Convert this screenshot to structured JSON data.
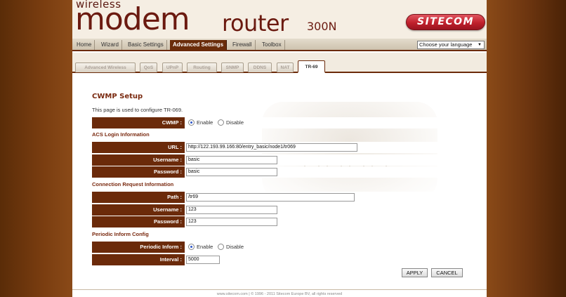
{
  "header": {
    "logo_top": "wireless",
    "logo_main": "modem",
    "logo_router": "router",
    "logo_model": "300N",
    "brand": "SITECOM"
  },
  "nav": {
    "items": [
      "Home",
      "Wizard",
      "Basic Settings",
      "Advanced Settings",
      "Firewall",
      "Toolbox"
    ],
    "active": "Advanced Settings",
    "language_select": "Choose your language"
  },
  "subtabs": {
    "items": [
      "Advanced Wireless",
      "QoS",
      "UPnP",
      "Routing",
      "SNMP",
      "DDNS",
      "NAT",
      "TR-69"
    ],
    "active": "TR-69"
  },
  "page": {
    "title": "CWMP Setup",
    "description": "This page is used to configure TR-069."
  },
  "cwmp": {
    "label": "CWMP :",
    "enable": "Enable",
    "disable": "Disable",
    "selected": "Enable"
  },
  "acs": {
    "section": "ACS Login Information",
    "url_label": "URL :",
    "url_value": "http://122.193.99.166:80/entry_basic/node1/tr069",
    "username_label": "Username :",
    "username_value": "basic",
    "password_label": "Password :",
    "password_value": "basic"
  },
  "conn_req": {
    "section": "Connection Request Information",
    "path_label": "Path :",
    "path_value": "/tr69",
    "username_label": "Username :",
    "username_value": "123",
    "password_label": "Password :",
    "password_value": "123"
  },
  "periodic": {
    "section": "Periodic Inform Config",
    "inform_label": "Periodic Inform :",
    "enable": "Enable",
    "disable": "Disable",
    "selected": "Enable",
    "interval_label": "Interval :",
    "interval_value": "5000"
  },
  "buttons": {
    "apply": "APPLY",
    "cancel": "CANCEL"
  },
  "footer": "www.sitecom.com | © 1996 - 2011 Sitecom Europe BV, all rights reserved"
}
